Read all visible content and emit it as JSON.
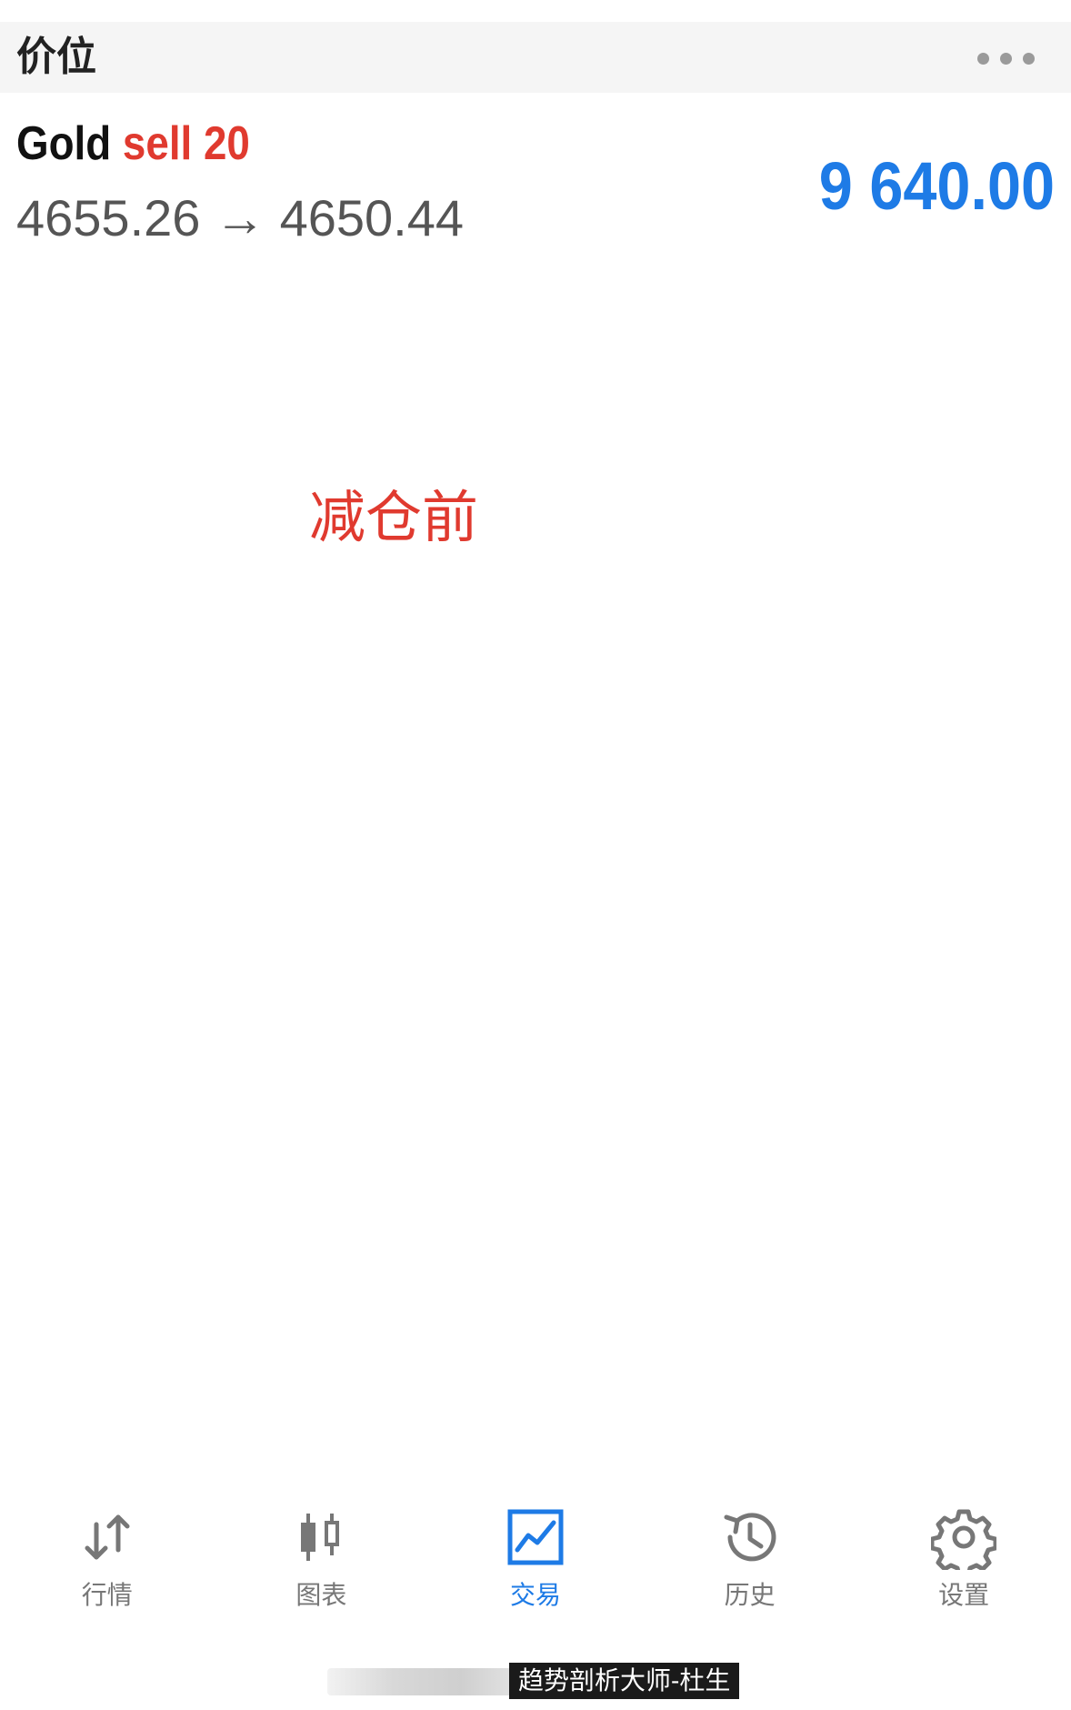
{
  "header": {
    "title": "价位",
    "menu_icon": "more-dots-icon"
  },
  "position": {
    "symbol": "Gold",
    "side": "sell",
    "volume": "20",
    "open_price": "4655.26",
    "arrow": "→",
    "current_price": "4650.44",
    "profit": "9 640.00"
  },
  "annotation": {
    "text": "减仓前"
  },
  "tabbar": {
    "items": [
      {
        "label": "行情",
        "icon": "quotes-arrows-icon",
        "active": false
      },
      {
        "label": "图表",
        "icon": "candlestick-chart-icon",
        "active": false
      },
      {
        "label": "交易",
        "icon": "trade-chart-icon",
        "active": true
      },
      {
        "label": "历史",
        "icon": "history-clock-icon",
        "active": false
      },
      {
        "label": "设置",
        "icon": "settings-gear-icon",
        "active": false
      }
    ]
  },
  "watermark": {
    "text": "趋势剖析大师-杜生"
  },
  "colors": {
    "accent": "#1e7be6",
    "sell": "#e03a2f",
    "inactive": "#777777"
  }
}
